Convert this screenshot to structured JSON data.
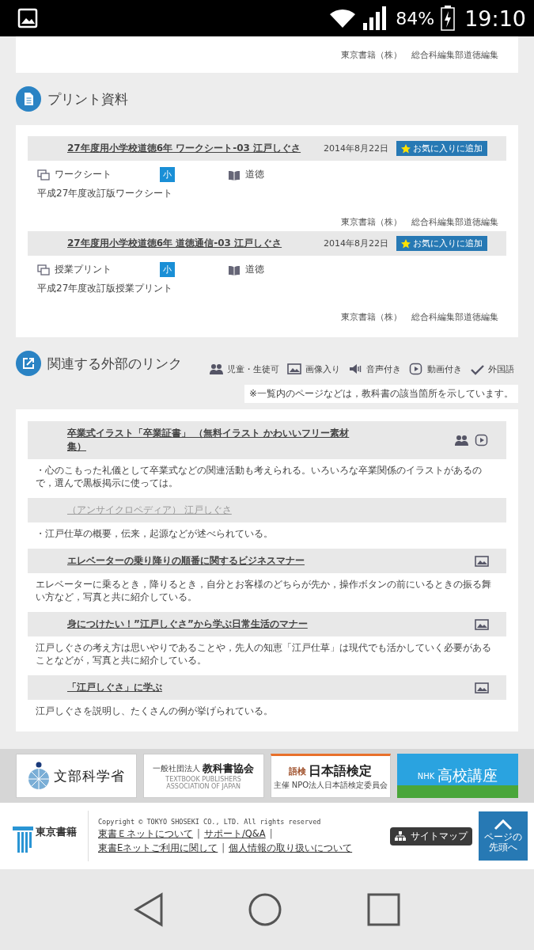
{
  "status_bar": {
    "battery": "84%",
    "time": "19:10"
  },
  "top_card": {
    "publisher": "東京書籍（株）",
    "editor": "総合科編集部道徳編集"
  },
  "print_section": {
    "title": "プリント資料",
    "items": [
      {
        "title": "27年度用小学校道徳6年 ワークシート-03 江戸しぐさ",
        "date": "2014年8月22日",
        "favorite": "お気に入りに追加",
        "type": "ワークシート",
        "level": "小",
        "subject": "道徳",
        "note": "平成27年度改訂版ワークシート",
        "publisher": "東京書籍（株）",
        "editor": "総合科編集部道徳編集"
      },
      {
        "title": "27年度用小学校道徳6年 道徳通信-03 江戸しぐさ",
        "date": "2014年8月22日",
        "favorite": "お気に入りに追加",
        "type": "授業プリント",
        "level": "小",
        "subject": "道徳",
        "note": "平成27年度改訂版授業プリント",
        "publisher": "東京書籍（株）",
        "editor": "総合科編集部道徳編集"
      }
    ]
  },
  "links_section": {
    "title": "関連する外部のリンク",
    "legend": [
      {
        "kind": "kids",
        "label": "児童・生徒可"
      },
      {
        "kind": "image",
        "label": "画像入り"
      },
      {
        "kind": "audio",
        "label": "音声付き"
      },
      {
        "kind": "video",
        "label": "動画付き"
      },
      {
        "kind": "foreign",
        "label": "外国語"
      }
    ],
    "note": "※一覧内のページなどは，教科書の該当箇所を示しています。",
    "items": [
      {
        "title": "卒業式イラスト「卒業証書」 （無料イラスト かわいいフリー素材集）",
        "visited": false,
        "icons": [
          {
            "kind": "kids"
          },
          {
            "kind": "video"
          }
        ],
        "description": "・心のこもった礼儀として卒業式などの関連活動も考えられる。いろいろな卒業関係のイラストがあるので，選んで黒板掲示に使っては。"
      },
      {
        "title": "（アンサイクロペディア） 江戸しぐさ",
        "visited": true,
        "description": "・江戸仕草の概要，伝来，起源などが述べられている。"
      },
      {
        "title": "エレベーターの乗り降りの順番に関するビジネスマナー",
        "visited": false,
        "icons": [
          {
            "kind": "image"
          }
        ],
        "description": "エレベーターに乗るとき，降りるとき，自分とお客様のどちらが先か，操作ボタンの前にいるときの振る舞い方など，写真と共に紹介している。"
      },
      {
        "title": "身につけたい！”江戸しぐさ”から学ぶ日常生活のマナー",
        "visited": false,
        "icons": [
          {
            "kind": "image"
          }
        ],
        "description": "江戸しぐさの考え方は思いやりであることや，先人の知恵「江戸仕草」は現代でも活かしていく必要があることなどが，写真と共に紹介している。"
      },
      {
        "title": "「江戸しぐさ」に学ぶ",
        "visited": false,
        "icons": [
          {
            "kind": "image"
          }
        ],
        "description": "江戸しぐさを説明し、たくさんの例が挙げられている。"
      }
    ]
  },
  "banners": [
    {
      "kind": "mext",
      "text": "文部科学省"
    },
    {
      "kind": "textbook",
      "small": "一般社団法人",
      "text": "教科書協会",
      "sub": "TEXTBOOK PUBLISHERS ASSOCIATION OF JAPAN"
    },
    {
      "kind": "kentei",
      "small": "語検",
      "text": "日本語検定",
      "sub": "主催 NPO法人日本語検定委員会"
    },
    {
      "kind": "nhk",
      "small": "NHK",
      "text": "高校講座"
    }
  ],
  "footer": {
    "logo": "東京書籍",
    "copyright": "Copyright © TOKYO SHOSEKI CO., LTD. All rights reserved",
    "links": [
      {
        "kind": "link",
        "text": "東書Ｅネットについて"
      },
      {
        "kind": "separator",
        "text": "|"
      },
      {
        "kind": "link",
        "text": "サポート/Q&A"
      },
      {
        "kind": "separator",
        "text": "|"
      },
      {
        "kind": "link",
        "text": "東書Eネットご利用に関して"
      },
      {
        "kind": "separator",
        "text": "|"
      },
      {
        "kind": "link",
        "text": "個人情報の取り扱いについて"
      }
    ],
    "sitemap": "サイトマップ",
    "page_top": "ページの先頭へ"
  }
}
